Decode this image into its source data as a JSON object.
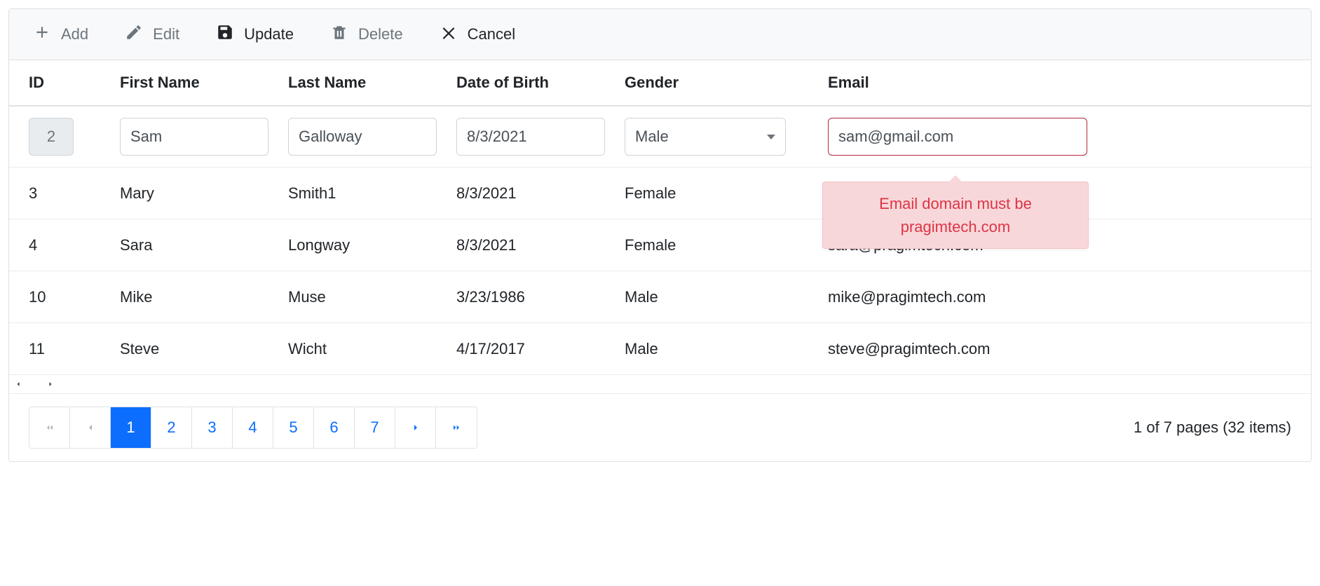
{
  "toolbar": {
    "add": "Add",
    "edit": "Edit",
    "update": "Update",
    "delete": "Delete",
    "cancel": "Cancel"
  },
  "columns": {
    "id": "ID",
    "first_name": "First Name",
    "last_name": "Last Name",
    "dob": "Date of Birth",
    "gender": "Gender",
    "email": "Email"
  },
  "edit_row": {
    "id": "2",
    "first_name": "Sam",
    "last_name": "Galloway",
    "dob": "8/3/2021",
    "gender": "Male",
    "email": "sam@gmail.com"
  },
  "validation": {
    "email_line1": "Email domain must be",
    "email_line2": "pragimtech.com"
  },
  "rows": [
    {
      "id": "3",
      "first_name": "Mary",
      "last_name": "Smith1",
      "dob": "8/3/2021",
      "gender": "Female",
      "email": ""
    },
    {
      "id": "4",
      "first_name": "Sara",
      "last_name": "Longway",
      "dob": "8/3/2021",
      "gender": "Female",
      "email": "sara@pragimtech.com"
    },
    {
      "id": "10",
      "first_name": "Mike",
      "last_name": "Muse",
      "dob": "3/23/1986",
      "gender": "Male",
      "email": "mike@pragimtech.com"
    },
    {
      "id": "11",
      "first_name": "Steve",
      "last_name": "Wicht",
      "dob": "4/17/2017",
      "gender": "Male",
      "email": "steve@pragimtech.com"
    }
  ],
  "pager": {
    "pages": [
      "1",
      "2",
      "3",
      "4",
      "5",
      "6",
      "7"
    ],
    "active_index": 0,
    "info": "1 of 7 pages (32 items)"
  }
}
